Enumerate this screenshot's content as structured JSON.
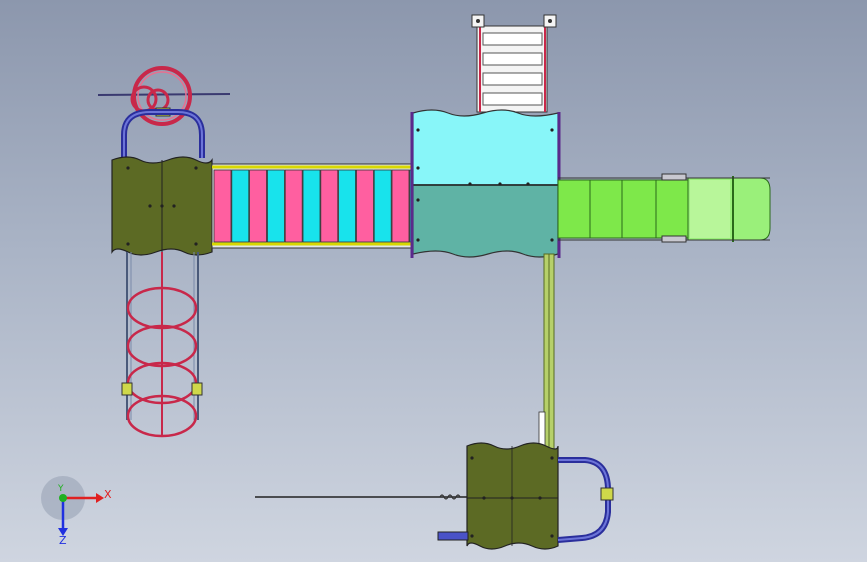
{
  "triad": {
    "x_label": "X",
    "y_label": "Y",
    "z_label": "Z",
    "x_color": "#e02020",
    "y_color": "#20b020",
    "z_color": "#2030e0"
  },
  "palette": {
    "olive_panel": "#5c6a24",
    "cyan_panel": "#88f6f9",
    "teal_panel": "#5fb3a5",
    "pink_slat": "#ff5fa0",
    "cyan_slat": "#18e3ec",
    "slide_green": "#7ee84a",
    "ring_red": "#c8284a",
    "rail_blue": "#2a2e9c",
    "ladder_white": "#f4f4f4",
    "support_green": "#b6d06a"
  }
}
